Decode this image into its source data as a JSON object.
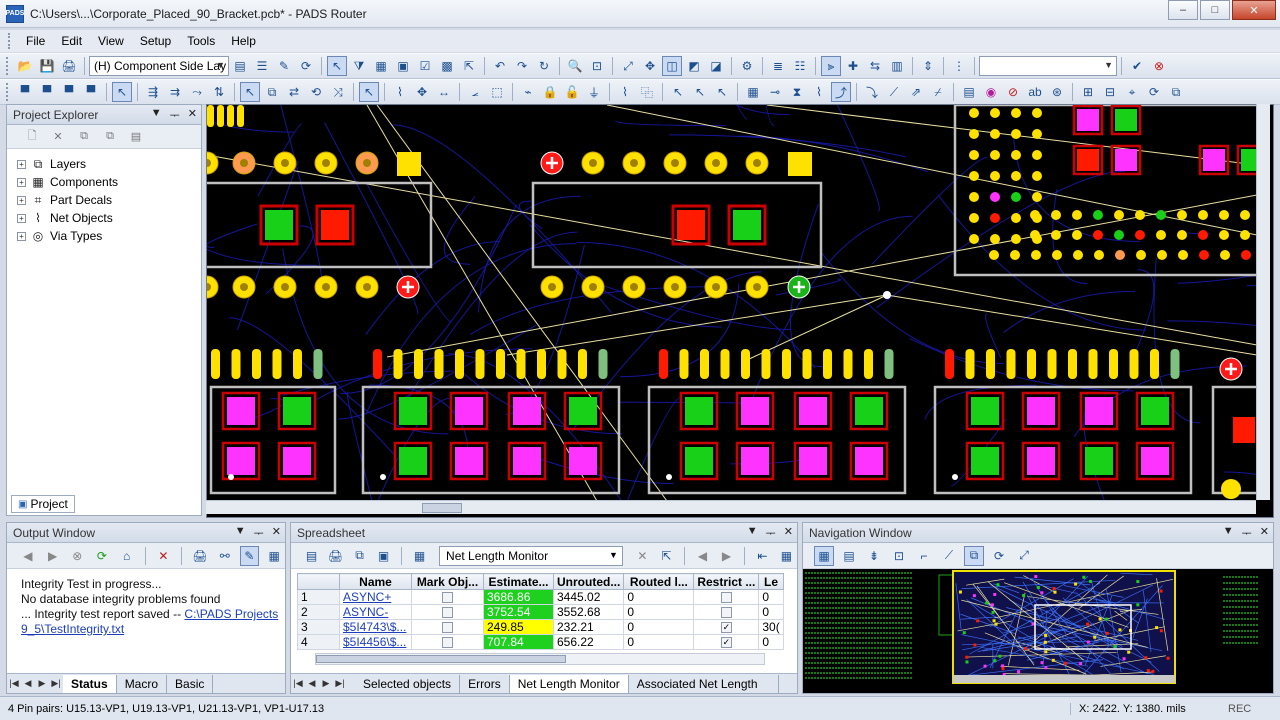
{
  "window": {
    "title": "C:\\Users\\...\\Corporate_Placed_90_Bracket.pcb* - PADS Router",
    "app_icon": "PADS",
    "minimize": "–",
    "maximize": "□",
    "close": "✕"
  },
  "menu": [
    "File",
    "Edit",
    "View",
    "Setup",
    "Tools",
    "Help"
  ],
  "toolbar": {
    "layer_select": "(H) Component Side Lay"
  },
  "project_explorer": {
    "title": "Project Explorer",
    "items": [
      "Layers",
      "Components",
      "Part Decals",
      "Net Objects",
      "Via Types"
    ],
    "tab": "Project"
  },
  "output_window": {
    "title": "Output Window",
    "lines": [
      "Integrity Test in progress...",
      "No database integrity problems found",
      "... Integrity test report saved -- "
    ],
    "link_text": "C:\\PADS Projects 9_5\\TestIntegrity.txt",
    "tabs": [
      "Status",
      "Macro",
      "Basic"
    ]
  },
  "spreadsheet": {
    "title": "Spreadsheet",
    "view_select": "Net Length Monitor",
    "columns": [
      "",
      "Name",
      "Mark Obj...",
      "Estimate...",
      "Unrouted...",
      "Routed l...",
      "Restrict ...",
      "Le"
    ],
    "rows": [
      {
        "n": "1",
        "name": "ASYNC+",
        "est": "3686.86",
        "unrouted": "3445.02",
        "routed": "0",
        "restrict": false,
        "le": "0",
        "est_color": "green"
      },
      {
        "n": "2",
        "name": "ASYNC-",
        "est": "3752.54",
        "unrouted": "3552.68",
        "routed": "0",
        "restrict": false,
        "le": "0",
        "est_color": "green"
      },
      {
        "n": "3",
        "name": "$5I4743\\$...",
        "est": "249.85",
        "unrouted": "232.21",
        "routed": "0",
        "restrict": true,
        "le": "30(",
        "est_color": "yellow"
      },
      {
        "n": "4",
        "name": "$5I4456\\$...",
        "est": "707.84",
        "unrouted": "656.22",
        "routed": "0",
        "restrict": true,
        "le": "0",
        "est_color": "green"
      }
    ],
    "tabs": [
      "Selected objects",
      "Errors",
      "Net Length Monitor",
      "Associated Net Length Monito"
    ]
  },
  "navigation_window": {
    "title": "Navigation Window"
  },
  "status": {
    "message": "4 Pin pairs: U15.13-VP1, U19.13-VP1, U21.13-VP1, VP1-U17.13",
    "coords": "X: 2422.  Y: 1380.  mils",
    "mode": "REC"
  },
  "colors": {
    "pad_yellow": "#ffe100",
    "pad_green": "#18d018",
    "pad_red": "#ff1a00",
    "pad_magenta": "#ff33ff",
    "outline": "#c0c0c0",
    "trace_blue": "#1a1ab3",
    "ratsnest": "#e8e0a0"
  }
}
